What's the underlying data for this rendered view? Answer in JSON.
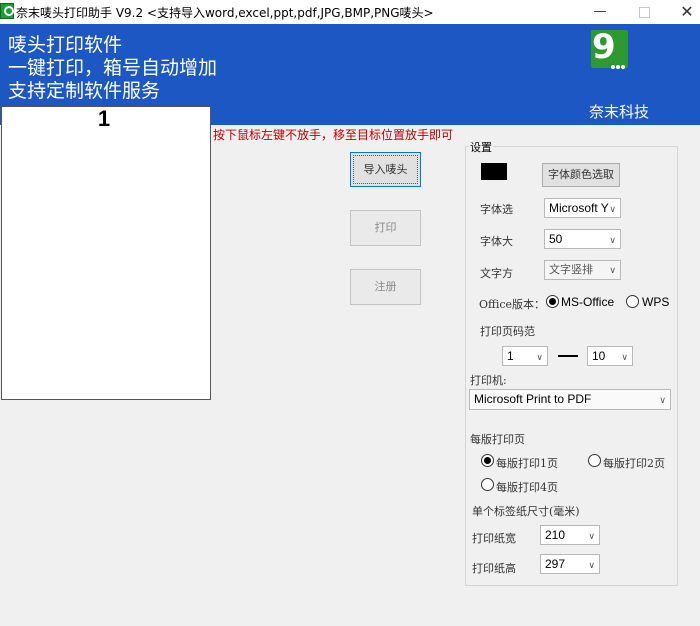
{
  "window": {
    "title": "奈末唛头打印助手  V9.2    <支持导入word,excel,ppt,pdf,JPG,BMP,PNG唛头>",
    "minimize_glyph": "—",
    "close_glyph": "✕"
  },
  "banner": {
    "line1": "唛头打印软件",
    "line2": "一键打印，箱号自动增加",
    "line3": "支持定制软件服务",
    "logo_text": "9",
    "company": "奈末科技",
    "background_color": "#1d57c4",
    "logo_color": "#2d9a2f"
  },
  "preview": {
    "page_number": "1"
  },
  "hint": {
    "drag_text": "按下鼠标左键不放手，移至目标位置放手即可",
    "color": "#c00000"
  },
  "actions": {
    "import_label": "导入唛头",
    "print_label": "打印",
    "register_label": "注册"
  },
  "settings": {
    "title": "设置",
    "font_color_button": "字体颜色选取",
    "font_color_value": "#000000",
    "font_label": "字体选",
    "font_value": "Microsoft Y",
    "size_label": "字体大",
    "size_value": "50",
    "direction_label": "文字方",
    "direction_value": "文字竖排",
    "office_label": "Office版本：",
    "office_options": [
      "MS-Office",
      "WPS"
    ],
    "office_selected": "MS-Office",
    "page_range_label": "打印页码范",
    "page_from": "1",
    "page_to": "10",
    "printer_label": "打印机:",
    "printer_value": "Microsoft Print to PDF",
    "per_page_label": "每版打印页",
    "per_page_options": [
      "每版打印1页",
      "每版打印2页",
      "每版打印4页"
    ],
    "per_page_selected": "每版打印1页",
    "label_size_title": "单个标签纸尺寸(毫米)",
    "width_label": "打印纸宽",
    "width_value": "210",
    "height_label": "打印纸高",
    "height_value": "297"
  }
}
